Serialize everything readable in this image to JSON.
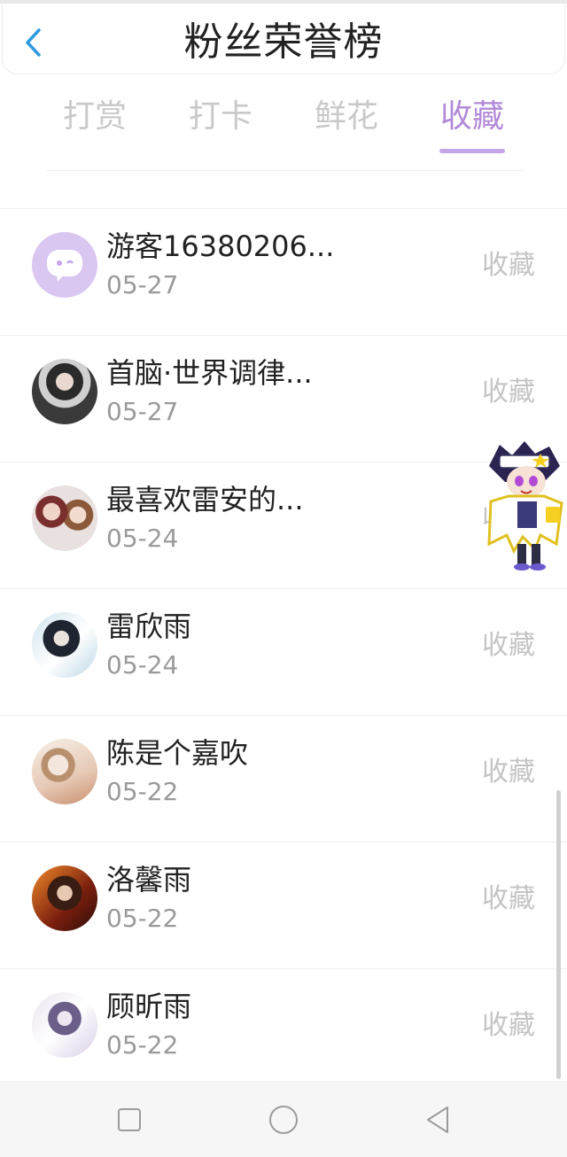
{
  "header": {
    "title": "粉丝荣誉榜",
    "back_icon": "chevron-left-icon"
  },
  "tabs": [
    {
      "label": "打赏",
      "active": false
    },
    {
      "label": "打卡",
      "active": false
    },
    {
      "label": "鲜花",
      "active": false
    },
    {
      "label": "收藏",
      "active": true
    }
  ],
  "list": [
    {
      "name": "游客16380206...",
      "date": "05-27",
      "action": "收藏",
      "avatar": "default-avatar"
    },
    {
      "name": "首脑·世界调律...",
      "date": "05-27",
      "action": "收藏",
      "avatar": "user-avatar"
    },
    {
      "name": "最喜欢雷安的...",
      "date": "05-24",
      "action": "收藏",
      "avatar": "user-avatar"
    },
    {
      "name": "雷欣雨",
      "date": "05-24",
      "action": "收藏",
      "avatar": "user-avatar"
    },
    {
      "name": "陈是个嘉吹",
      "date": "05-22",
      "action": "收藏",
      "avatar": "user-avatar"
    },
    {
      "name": "洛馨雨",
      "date": "05-22",
      "action": "收藏",
      "avatar": "user-avatar"
    },
    {
      "name": "顾昕雨",
      "date": "05-22",
      "action": "收藏",
      "avatar": "user-avatar"
    }
  ],
  "floating_mascot": "anime-mascot-sticker",
  "system_nav": {
    "recents_icon": "square-icon",
    "home_icon": "circle-icon",
    "back_icon": "triangle-back-icon"
  },
  "colors": {
    "accent": "#b28ad9",
    "back_arrow": "#2f9ae0",
    "inactive_tab": "#c9c9c9",
    "date": "#9a9a9a"
  }
}
